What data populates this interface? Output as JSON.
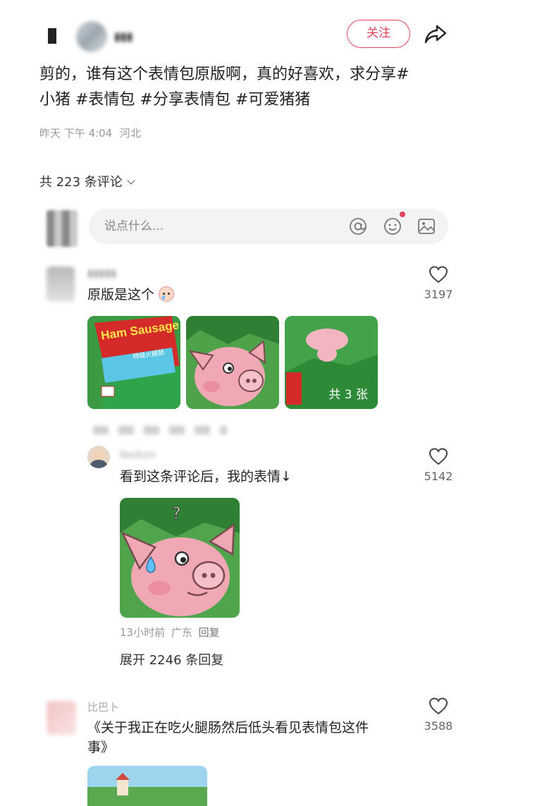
{
  "header": {
    "follow_label": "关注"
  },
  "post": {
    "text_line1": "剪的，谁有这个表情包原版啊，真的好喜欢，求分享#",
    "text_line2": "小猪 #表情包 #分享表情包 #可爱猪猪",
    "time": "昨天 下午 4:04",
    "location": "河北"
  },
  "comments_section": {
    "count_label": "共 223 条评论",
    "input_placeholder": "说点什么..."
  },
  "comments": [
    {
      "text": "原版是这个",
      "likes": "3197",
      "images_more": "共 3 张",
      "image_labels": [
        "Ham Sausage King",
        "特级火腿肠"
      ]
    },
    {
      "author": "Nelkon",
      "text": "看到这条评论后，我的表情↓",
      "likes": "5142",
      "time": "13小时前",
      "location": "广东",
      "reply_label": "回复",
      "expand_label": "展开 2246 条回复"
    },
    {
      "author": "比巴卜",
      "text_line1": "《关于我正在吃火腿肠然后低头看见表情包这件",
      "text_line2": "事》",
      "likes": "3588"
    }
  ],
  "icons": {
    "share": "share-icon",
    "at": "at-icon",
    "emoji": "emoji-icon",
    "image": "image-icon",
    "like": "heart-icon"
  },
  "colors": {
    "accent": "#e0455a",
    "muted": "#999999"
  }
}
